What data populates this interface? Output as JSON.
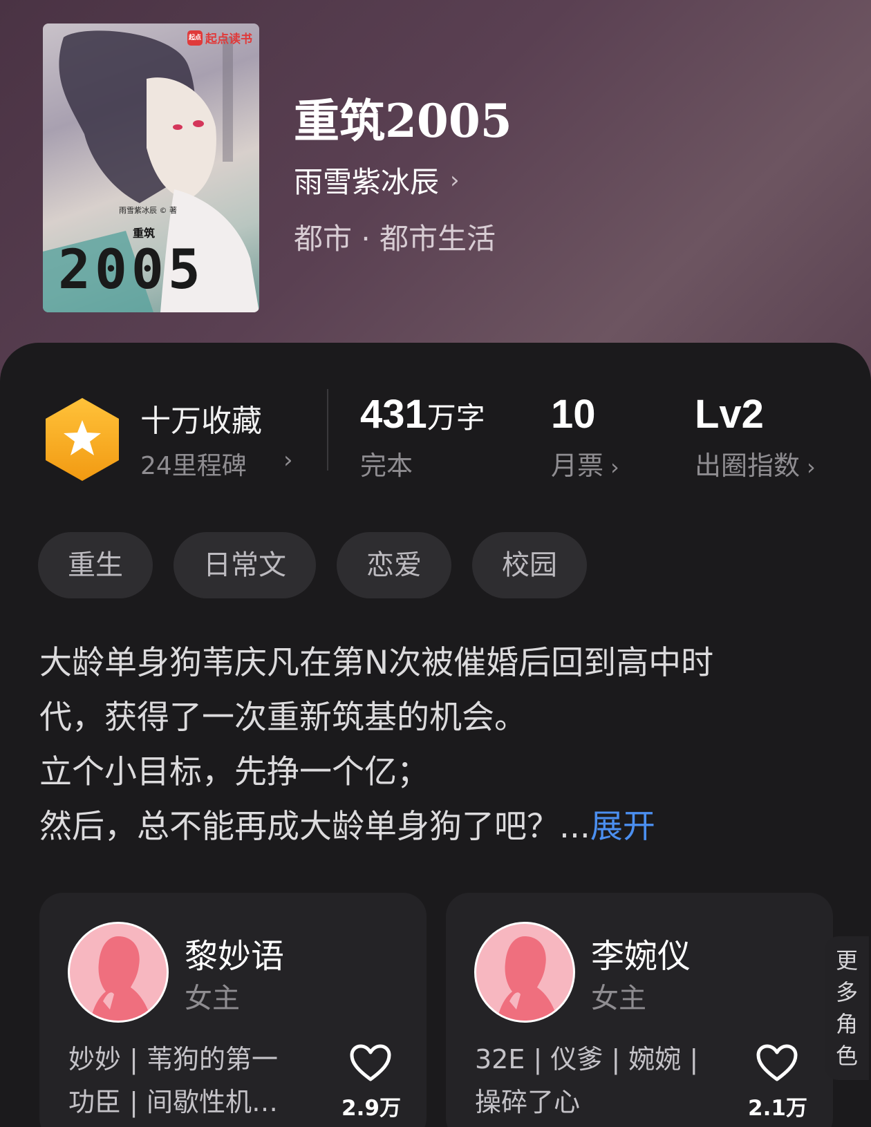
{
  "cover": {
    "brand": "起点读书",
    "brand_logo": "起点",
    "author_line": "雨雪紫冰辰 © 著",
    "title_small": "重筑",
    "title_big": "2005"
  },
  "book": {
    "title": "重筑2005",
    "author": "雨雪紫冰辰",
    "genre": "都市 · 都市生活"
  },
  "stats": {
    "collect_title": "十万收藏",
    "collect_sub": "24里程碑",
    "words_value": "431",
    "words_unit": "万字",
    "words_label": "完本",
    "tickets_value": "10",
    "tickets_label": "月票",
    "level_value": "Lv2",
    "level_label": "出圈指数"
  },
  "tags": [
    "重生",
    "日常文",
    "恋爱",
    "校园"
  ],
  "description": {
    "lines": [
      "大龄单身狗苇庆凡在第N次被催婚后回到高中时",
      "代，获得了一次重新筑基的机会。",
      "立个小目标，先挣一个亿；",
      "然后，总不能再成大龄单身狗了吧？..."
    ],
    "expand": "展开"
  },
  "characters": [
    {
      "name": "黎妙语",
      "role": "女主",
      "desc_line1": "妙妙 | 苇狗的第一",
      "desc_line2": "功臣 | 间歇性机…",
      "likes": "2.9万"
    },
    {
      "name": "李婉仪",
      "role": "女主",
      "desc_line1": "32E | 仪爹 | 婉婉 |",
      "desc_line2": "操碎了心",
      "likes": "2.1万"
    }
  ],
  "more_roles": [
    "更",
    "多",
    "角",
    "色"
  ],
  "colors": {
    "accent_blue": "#4b8ff0",
    "badge_gold": "#f5a623",
    "avatar_pink": "#f7b7c0"
  },
  "icons": [
    "star-badge-icon",
    "chevron-right-icon",
    "heart-icon",
    "avatar-silhouette-icon"
  ]
}
